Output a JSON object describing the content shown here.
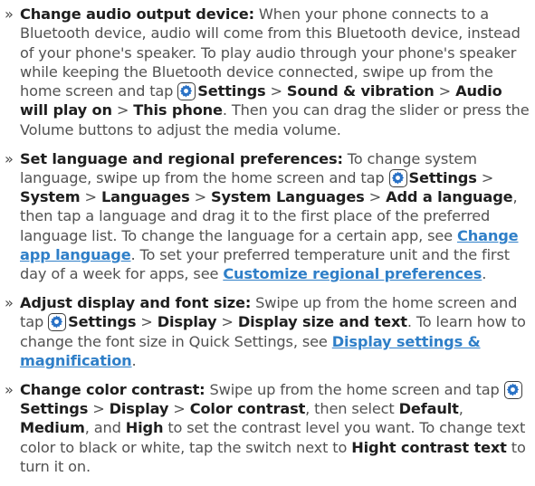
{
  "bullet": "»",
  "colors": {
    "text": "#525252",
    "bold": "#1f1f1f",
    "link": "#2f7fc8",
    "icon_fill": "#2a72c6"
  },
  "items": [
    {
      "title": "Change audio output device:",
      "p1": " When your phone connects to a Bluetooth device, audio will come from this Bluetooth device, instead of your phone's speaker. To play audio through your phone's speaker while keeping the Bluetooth device connected, swipe up from the home screen and tap ",
      "path": [
        "Settings",
        "Sound & vibration",
        "Audio will play on",
        "This phone"
      ],
      "p2": ". Then you can drag the slider or press the Volume buttons to adjust the media volume."
    },
    {
      "title": "Set language and regional preferences:",
      "p1": " To change system language, swipe up from the home screen and tap ",
      "path": [
        "Settings",
        "System",
        "Languages",
        "System Languages",
        "Add a language"
      ],
      "p2": ", then tap a language and drag it to the first place of the preferred language list. To change the language for a certain app, see ",
      "link1": "Change app language",
      "p3": ". To set your preferred temperature unit and the first day of a week for apps, see ",
      "link2": "Customize regional preferences",
      "p4": "."
    },
    {
      "title": "Adjust display and font size:",
      "p1": " Swipe up from the home screen and tap ",
      "path": [
        "Settings",
        "Display",
        "Display size and text"
      ],
      "p2": ". To learn how to change the font size in Quick Settings, see ",
      "link1": "Display settings & magnification",
      "p3": "."
    },
    {
      "title": "Change color contrast:",
      "p1": " Swipe up from the home screen and tap ",
      "path": [
        "Settings",
        "Display",
        "Color contrast"
      ],
      "p2": ", then select ",
      "opt1": "Default",
      "c1": ", ",
      "opt2": "Medium",
      "c2": ", and ",
      "opt3": "High",
      "p3": " to set the contrast level you want. To change text color to black or white, tap the switch next to ",
      "opt4": "Hight contrast text",
      "p4": " to turn it on."
    }
  ],
  "separator": " > "
}
